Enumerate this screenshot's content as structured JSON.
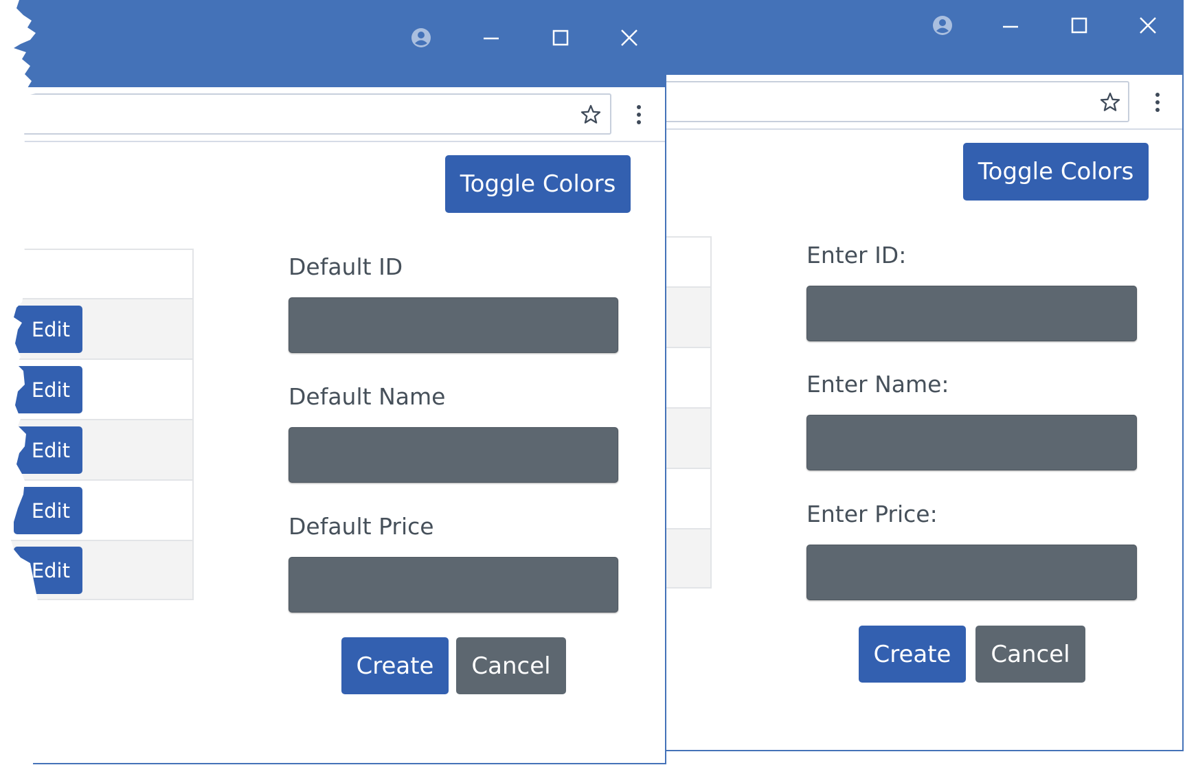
{
  "colors": {
    "chrome_blue": "#4472b8",
    "primary_button": "#3360b0",
    "secondary_button": "#5d6770",
    "input_fill": "#5d6770",
    "label_text": "#46505a",
    "row_alt": "#f3f3f3"
  },
  "icons": {
    "profile": "account-circle-icon",
    "minimize": "minimize-icon",
    "maximize": "maximize-icon",
    "close": "close-icon",
    "bookmark": "star-icon",
    "menu": "more-vert-icon"
  },
  "left_window": {
    "toggle_label": "Toggle Colors",
    "table": {
      "edit_buttons": [
        "Edit",
        "Edit",
        "Edit",
        "Edit",
        "Edit"
      ]
    },
    "form": {
      "fields": [
        {
          "label": "Default ID",
          "value": ""
        },
        {
          "label": "Default Name",
          "value": ""
        },
        {
          "label": "Default Price",
          "value": ""
        }
      ],
      "create_label": "Create",
      "cancel_label": "Cancel"
    }
  },
  "right_window": {
    "toggle_label": "Toggle Colors",
    "form": {
      "fields": [
        {
          "label": "Enter ID:",
          "value": ""
        },
        {
          "label": "Enter Name:",
          "value": ""
        },
        {
          "label": "Enter Price:",
          "value": ""
        }
      ],
      "create_label": "Create",
      "cancel_label": "Cancel"
    }
  }
}
